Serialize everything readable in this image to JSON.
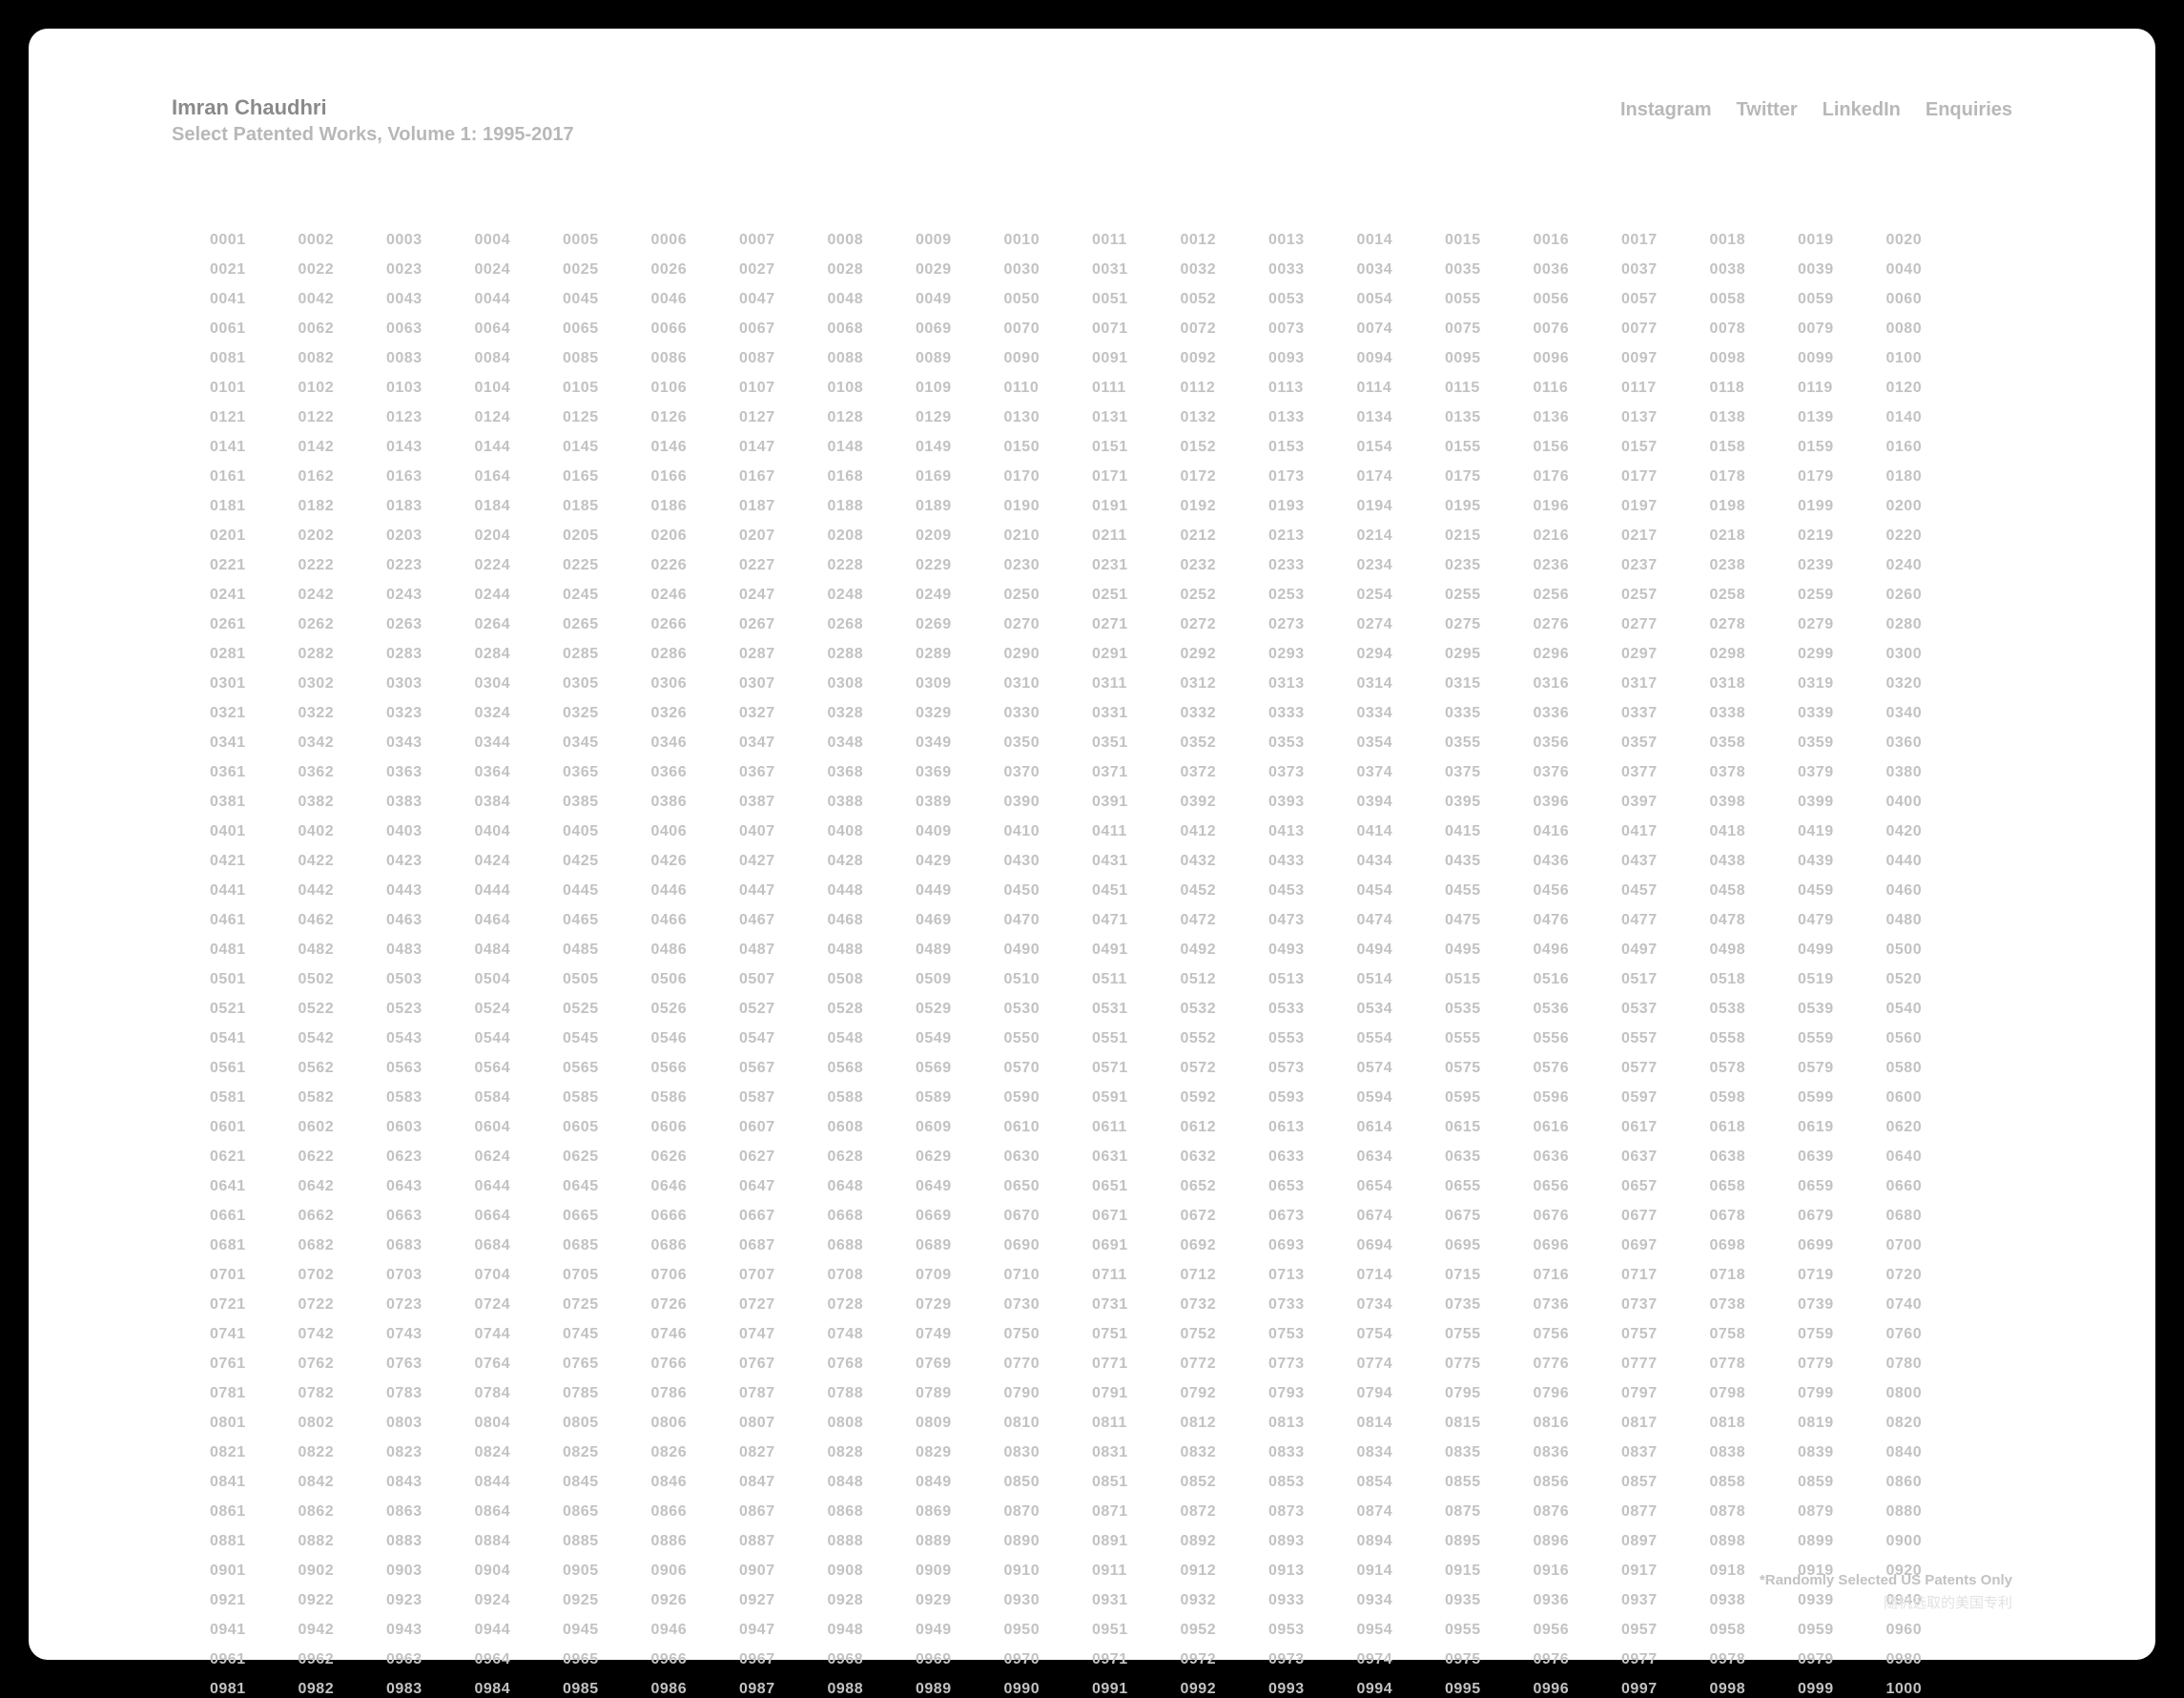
{
  "header": {
    "name": "Imran Chaudhri",
    "subtitle": "Select Patented Works, Volume 1: 1995-2017"
  },
  "nav": {
    "instagram": "Instagram",
    "twitter": "Twitter",
    "linkedin": "LinkedIn",
    "enquiries": "Enquiries"
  },
  "grid": {
    "start": 1,
    "end": 1000,
    "pad": 4,
    "cols": 20
  },
  "footer": {
    "en": "*Randomly Selected US Patents Only",
    "cn": "随机选取的美国专利"
  }
}
